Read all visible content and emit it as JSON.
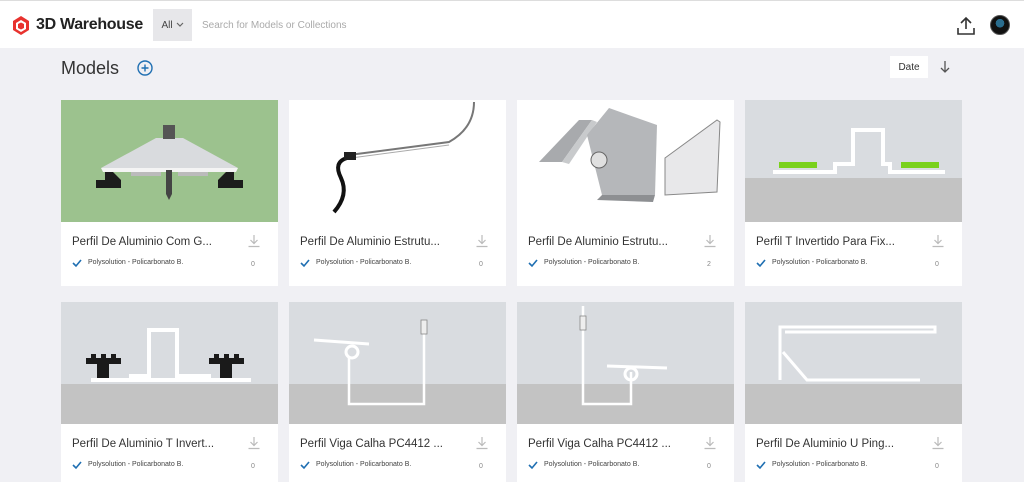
{
  "header": {
    "app_name": "3D Warehouse",
    "search_filter": "All",
    "search_placeholder": "Search for Models or Collections"
  },
  "page": {
    "title": "Models",
    "sort_label": "Date"
  },
  "models": [
    {
      "title": "Perfil De Aluminio Com G...",
      "owner": "Polysolution - Policarbonato B.",
      "count": "0"
    },
    {
      "title": "Perfil De Aluminio Estrutu...",
      "owner": "Polysolution - Policarbonato B.",
      "count": "0"
    },
    {
      "title": "Perfil De Aluminio Estrutu...",
      "owner": "Polysolution - Policarbonato B.",
      "count": "2"
    },
    {
      "title": "Perfil T Invertido Para Fix...",
      "owner": "Polysolution - Policarbonato B.",
      "count": "0"
    },
    {
      "title": "Perfil De Aluminio T Invert...",
      "owner": "Polysolution - Policarbonato B.",
      "count": "0"
    },
    {
      "title": "Perfil Viga Calha PC4412 ...",
      "owner": "Polysolution - Policarbonato B.",
      "count": "0"
    },
    {
      "title": "Perfil Viga Calha PC4412 ...",
      "owner": "Polysolution - Policarbonato B.",
      "count": "0"
    },
    {
      "title": "Perfil De Aluminio U Ping...",
      "owner": "Polysolution - Policarbonato B.",
      "count": "0"
    }
  ],
  "colors": {
    "logo_red": "#e8322e",
    "accent_blue": "#1f6fb2",
    "background": "#f0f0f4"
  }
}
